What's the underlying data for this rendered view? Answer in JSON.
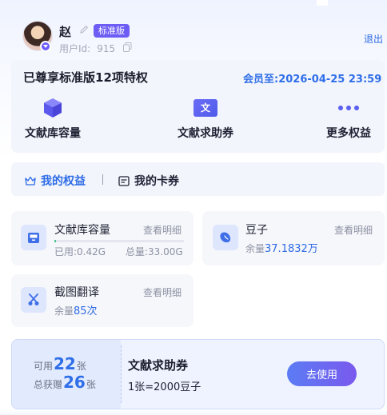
{
  "header": {
    "username": "赵",
    "plan_badge": "标准版",
    "userid_label": "用户Id:",
    "userid_value": "915",
    "logout_label": "退出"
  },
  "privileges": {
    "title": "已尊享标准版12项特权",
    "member_until": "会员至:2026-04-25 23:59",
    "items": [
      {
        "label": "文献库容量",
        "icon": "cube-icon"
      },
      {
        "label": "文献求助券",
        "icon": "doc-coupon-icon"
      },
      {
        "label": "更多权益",
        "icon": "more-dots-icon"
      }
    ],
    "coupon_icon_char": "文"
  },
  "tabs": [
    {
      "label": "我的权益",
      "active": true
    },
    {
      "label": "我的卡券",
      "active": false
    }
  ],
  "benefits": {
    "library": {
      "title": "文献库容量",
      "detail": "查看明细",
      "used": "已用:0.42G",
      "total": "总量:33.00G",
      "usage_fraction": 0.013
    },
    "beans": {
      "title": "豆子",
      "detail": "查看明细",
      "balance_label": "余量",
      "balance_value": "37.1832万"
    },
    "screenshot": {
      "title": "截图翻译",
      "detail": "查看明细",
      "balance_label": "余量",
      "balance_value": "85次"
    }
  },
  "coupon": {
    "available_label": "可用",
    "available_value": "22",
    "available_unit": "张",
    "gifted_label": "总获赠",
    "gifted_value": "26",
    "gifted_unit": "张",
    "title": "文献求助券",
    "desc": "1张=2000豆子",
    "button": "去使用"
  },
  "colors": {
    "accent_blue": "#2e6ee8",
    "badge_purple": "#6d5df5",
    "progress_green": "#2fbe7c"
  }
}
